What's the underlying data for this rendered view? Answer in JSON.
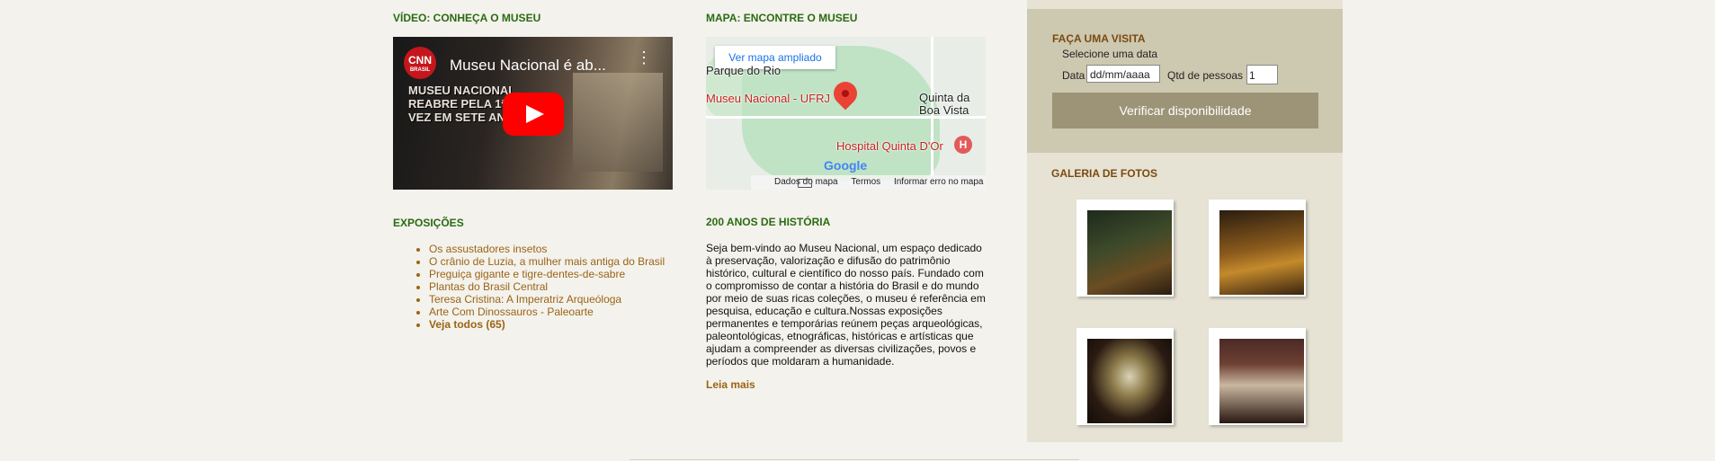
{
  "video": {
    "heading": "VÍDEO: CONHEÇA O MUSEU",
    "channel": "CNN",
    "channel_sub": "BRASIL",
    "title": "Museu Nacional é ab...",
    "overlay": "MUSEU NACIONAL\nREABRE PELA 1ª\nVEZ EM SETE AN"
  },
  "map": {
    "heading": "MAPA: ENCONTRE O MUSEU",
    "button": "Ver mapa ampliado",
    "labels": {
      "parque": "Parque do Rio",
      "museu": "Museu Nacional - UFRJ",
      "quinta1": "Quinta da",
      "quinta2": "Boa Vista",
      "hospital": "Hospital Quinta D'Or",
      "hospital_icon": "H"
    },
    "logo": "Google",
    "footer": [
      "Dados do mapa",
      "Termos",
      "Informar erro no mapa"
    ]
  },
  "exposicoes": {
    "heading": "EXPOSIÇÕES",
    "items": [
      "Os assustadores insetos",
      "O crânio de Luzia, a mulher mais antiga do Brasil",
      "Preguiça gigante e tigre-dentes-de-sabre",
      "Plantas do Brasil Central",
      "Teresa Cristina: A Imperatriz Arqueóloga",
      "Arte Com Dinossauros - Paleoarte"
    ],
    "see_all": "Veja todos (65)"
  },
  "historia": {
    "heading": "200 ANOS DE HISTÓRIA",
    "text": "Seja bem-vindo ao Museu Nacional, um espaço dedicado à preservação, valorização e difusão do patrimônio histórico, cultural e científico do nosso país. Fundado com o compromisso de contar a história do Brasil e do mundo por meio de suas ricas coleções, o museu é referência em pesquisa, educação e cultura.Nossas exposições permanentes e temporárias reúnem peças arqueológicas, paleontológicas, etnográficas, históricas e artísticas que ajudam a compreender as diversas civilizações, povos e períodos que moldaram a humanidade.",
    "more": "Leia mais"
  },
  "visita": {
    "heading": "FAÇA UMA VISITA",
    "select_date": "Selecione uma data",
    "date_label": "Data",
    "date_placeholder": "dd/mm/aaaa",
    "qty_label": "Qtd de pessoas",
    "qty_value": "1",
    "button": "Verificar disponibilidade"
  },
  "galeria": {
    "heading": "GALERIA DE FOTOS"
  },
  "colors": {
    "heading_green": "#2b6b12",
    "link_brown": "#9c6414",
    "sidebar_heading": "#7b4a10",
    "button_bg": "#9d9477"
  }
}
